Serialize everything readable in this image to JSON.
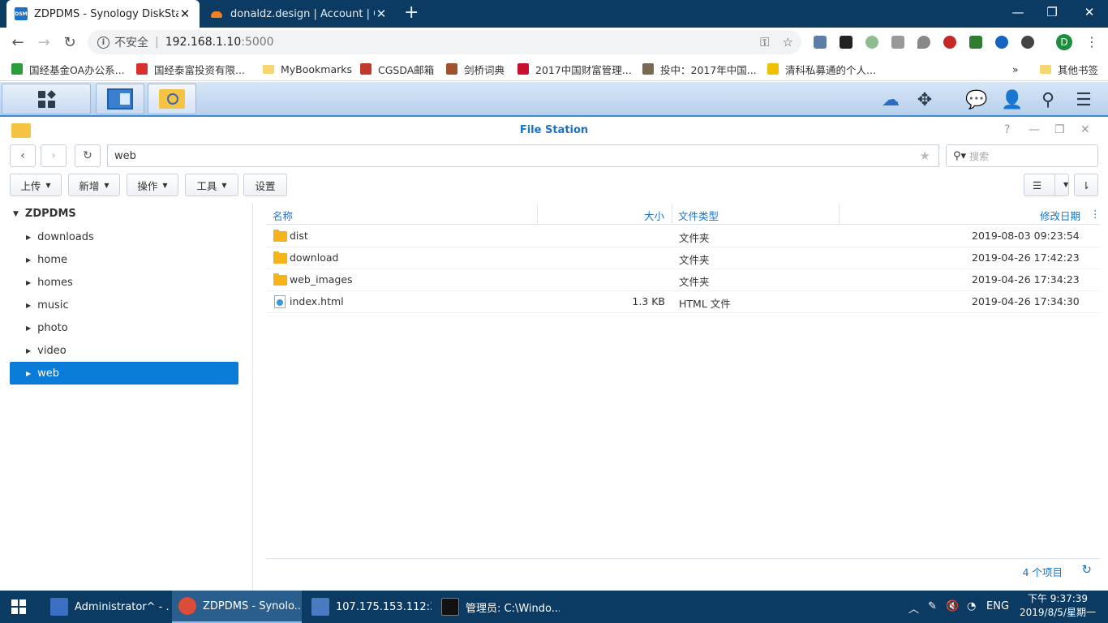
{
  "browser": {
    "tabs": [
      {
        "title": "ZDPDMS - Synology DiskStation",
        "favicon": "DSM"
      },
      {
        "title": "donaldz.design | Account | Cloudflare"
      }
    ],
    "new_tab": "+",
    "window_controls": {
      "minimize": "—",
      "restore": "❐",
      "close": "✕"
    },
    "address": {
      "security_label": "不安全",
      "host": "192.168.1.10",
      "port": ":5000"
    },
    "profile_initial": "D",
    "bookmarks": [
      {
        "label": "国经基金OA办公系...",
        "color": "#2a9d3c"
      },
      {
        "label": "国经泰富投资有限...",
        "color": "#d9302c"
      },
      {
        "label": "MyBookmarks",
        "folder": true
      },
      {
        "label": "CGSDA邮箱",
        "color": "#c0392b"
      },
      {
        "label": "剑桥词典",
        "color": "#a0522d"
      },
      {
        "label": "2017中国财富管理...",
        "color": "#c8102e"
      },
      {
        "label": "投中：2017年中国...",
        "color": "#7a6a55"
      },
      {
        "label": "清科私募通的个人...",
        "color": "#f0c000"
      }
    ],
    "bookmarks_overflow": "»",
    "other_bookmarks": "其他书签"
  },
  "dsm": {
    "window_title": "File Station"
  },
  "filestation": {
    "path": "web",
    "search_placeholder": "搜索",
    "toolbar": {
      "upload": "上传",
      "create": "新增",
      "action": "操作",
      "tools": "工具",
      "settings": "设置"
    },
    "tree": {
      "root": "ZDPDMS",
      "items": [
        "downloads",
        "home",
        "homes",
        "music",
        "photo",
        "video",
        "web"
      ],
      "selected": "web"
    },
    "columns": {
      "name": "名称",
      "size": "大小",
      "type": "文件类型",
      "modified": "修改日期"
    },
    "files": [
      {
        "name": "dist",
        "size": "",
        "type": "文件夹",
        "modified": "2019-08-03 09:23:54",
        "kind": "folder"
      },
      {
        "name": "download",
        "size": "",
        "type": "文件夹",
        "modified": "2019-04-26 17:42:23",
        "kind": "folder"
      },
      {
        "name": "web_images",
        "size": "",
        "type": "文件夹",
        "modified": "2019-04-26 17:34:23",
        "kind": "folder"
      },
      {
        "name": "index.html",
        "size": "1.3 KB",
        "type": "HTML 文件",
        "modified": "2019-04-26 17:34:30",
        "kind": "html"
      }
    ],
    "item_count": "4 个项目"
  },
  "taskbar": {
    "tasks": [
      {
        "label": "Administrator^ - ...",
        "color": "#3b6fc4"
      },
      {
        "label": "ZDPDMS - Synolo...",
        "color": "#dd4b39"
      },
      {
        "label": "107.175.153.112:3...",
        "color": "#4a7bc0"
      },
      {
        "label": "管理员: C:\\Windo...",
        "color": "#111111"
      }
    ],
    "language": "ENG",
    "time": "下午 9:37:39",
    "date": "2019/8/5/星期一"
  }
}
